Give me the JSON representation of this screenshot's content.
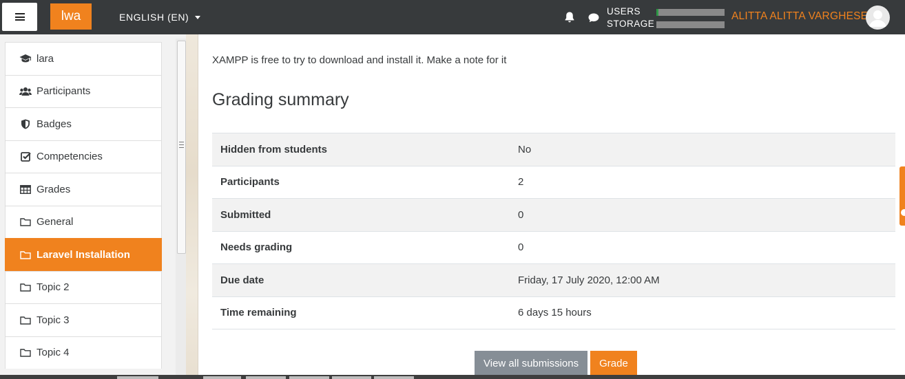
{
  "navbar": {
    "logo": "lwa",
    "language": "ENGLISH (EN)",
    "usage_users_label": "USERS",
    "usage_storage_label": "STORAGE",
    "users_usage_fraction": 0.03,
    "storage_usage_fraction": 0.0,
    "username": "ALITTA ALITTA VARGHESE"
  },
  "drawer": {
    "items": [
      {
        "label": "lara",
        "icon": "graduation-cap-icon"
      },
      {
        "label": "Participants",
        "icon": "users-icon"
      },
      {
        "label": "Badges",
        "icon": "shield-icon"
      },
      {
        "label": "Competencies",
        "icon": "check-square-icon"
      },
      {
        "label": "Grades",
        "icon": "table-icon"
      },
      {
        "label": "General",
        "icon": "folder-icon"
      },
      {
        "label": "Laravel Installation",
        "icon": "folder-icon",
        "active": true
      },
      {
        "label": "Topic 2",
        "icon": "folder-icon"
      },
      {
        "label": "Topic 3",
        "icon": "folder-icon"
      },
      {
        "label": "Topic 4",
        "icon": "folder-icon"
      }
    ]
  },
  "main": {
    "intro": "XAMPP is free to try to download and install it. Make a note for it",
    "section_title": "Grading summary",
    "summary": [
      {
        "label": "Hidden from students",
        "value": "No"
      },
      {
        "label": "Participants",
        "value": "2"
      },
      {
        "label": "Submitted",
        "value": "0"
      },
      {
        "label": "Needs grading",
        "value": "0"
      },
      {
        "label": "Due date",
        "value": "Friday, 17 July 2020, 12:00 AM"
      },
      {
        "label": "Time remaining",
        "value": "6 days 15 hours"
      }
    ],
    "view_all_label": "View all submissions",
    "grade_label": "Grade"
  },
  "colors": {
    "accent": "#f0821e",
    "navbar": "#373a3c",
    "secondary_button": "#868e96"
  }
}
